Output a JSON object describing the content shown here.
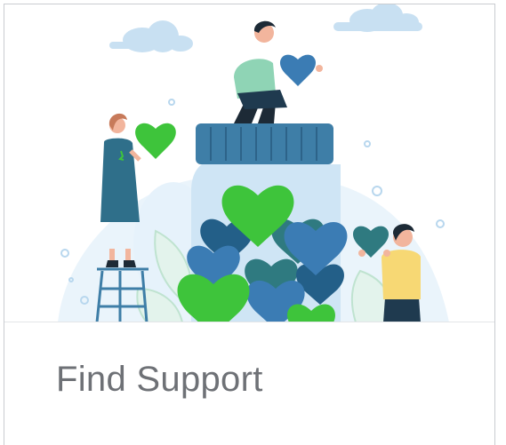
{
  "card": {
    "title": "Find Support",
    "illustration": {
      "subject": "heart-jar",
      "colors": {
        "primary_green": "#3ec43b",
        "dark_green": "#1f9b2e",
        "blue": "#3b7cb4",
        "dark_blue": "#235f88",
        "teal": "#2f7a80",
        "jar_lid": "#3e7ea7",
        "jar_glass": "#cfe5f5",
        "background_blob": "#eaf4fb",
        "cloud": "#c8e0f2",
        "skin": "#f2b59d",
        "hair": "#1d2a36",
        "shirt_mint": "#8fd4b5",
        "shirt_yellow": "#f7d874",
        "pants_dark": "#1f3a4f"
      }
    }
  }
}
